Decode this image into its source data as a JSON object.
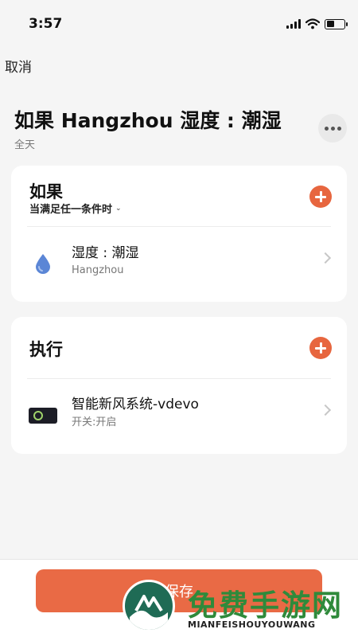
{
  "status_bar": {
    "time": "3:57",
    "battery_level": 0.45
  },
  "header": {
    "cancel_label": "取消",
    "title": "如果 Hangzhou 湿度 : 潮湿",
    "subtitle": "全天"
  },
  "if_section": {
    "title": "如果",
    "condition_mode": "当满足任一条件时",
    "items": [
      {
        "title": "湿度 : 潮湿",
        "subtitle": "Hangzhou",
        "icon": "water-drop-icon",
        "icon_color": "#5b86d6"
      }
    ]
  },
  "do_section": {
    "title": "执行",
    "items": [
      {
        "title": "智能新风系统-vdevo",
        "subtitle": "开关:开启",
        "icon": "device-icon"
      }
    ]
  },
  "footer": {
    "save_label": "保存"
  },
  "watermark": {
    "text": "免费手游网",
    "subtext": "MIANFEISHOUYOUWANG"
  },
  "colors": {
    "accent": "#e7663f",
    "save_button": "#e96a45",
    "watermark_green": "#2f8a3b"
  }
}
